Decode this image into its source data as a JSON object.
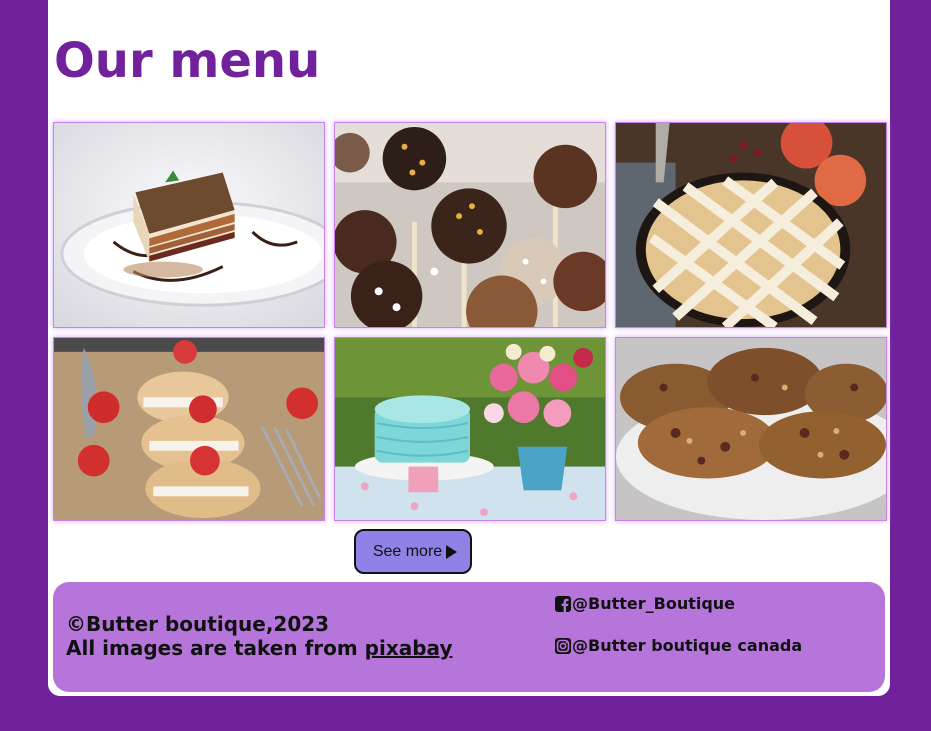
{
  "page": {
    "title": "Our menu"
  },
  "gallery": {
    "images": [
      {
        "name": "layered-cake-slice-image"
      },
      {
        "name": "chocolate-cake-pops-image"
      },
      {
        "name": "lattice-apple-pie-image"
      },
      {
        "name": "strawberry-cream-puffs-image"
      },
      {
        "name": "ruffle-cake-and-flowers-image"
      },
      {
        "name": "fruit-nut-cookies-image"
      }
    ],
    "see_more_label": "See more"
  },
  "footer": {
    "copyright": "©Butter boutique,2023",
    "credit_prefix": "All images are taken from ",
    "credit_link": "pixabay",
    "facebook_handle": "@Butter_Boutique",
    "instagram_handle": "@Butter boutique canada"
  },
  "colors": {
    "brand": "#72219d",
    "footer_bg": "#b575db",
    "button_bg": "#8f82e6",
    "tile_border": "#c784e8"
  },
  "icons": {
    "play": "play-triangle-icon",
    "facebook": "facebook-icon",
    "instagram": "instagram-icon"
  }
}
